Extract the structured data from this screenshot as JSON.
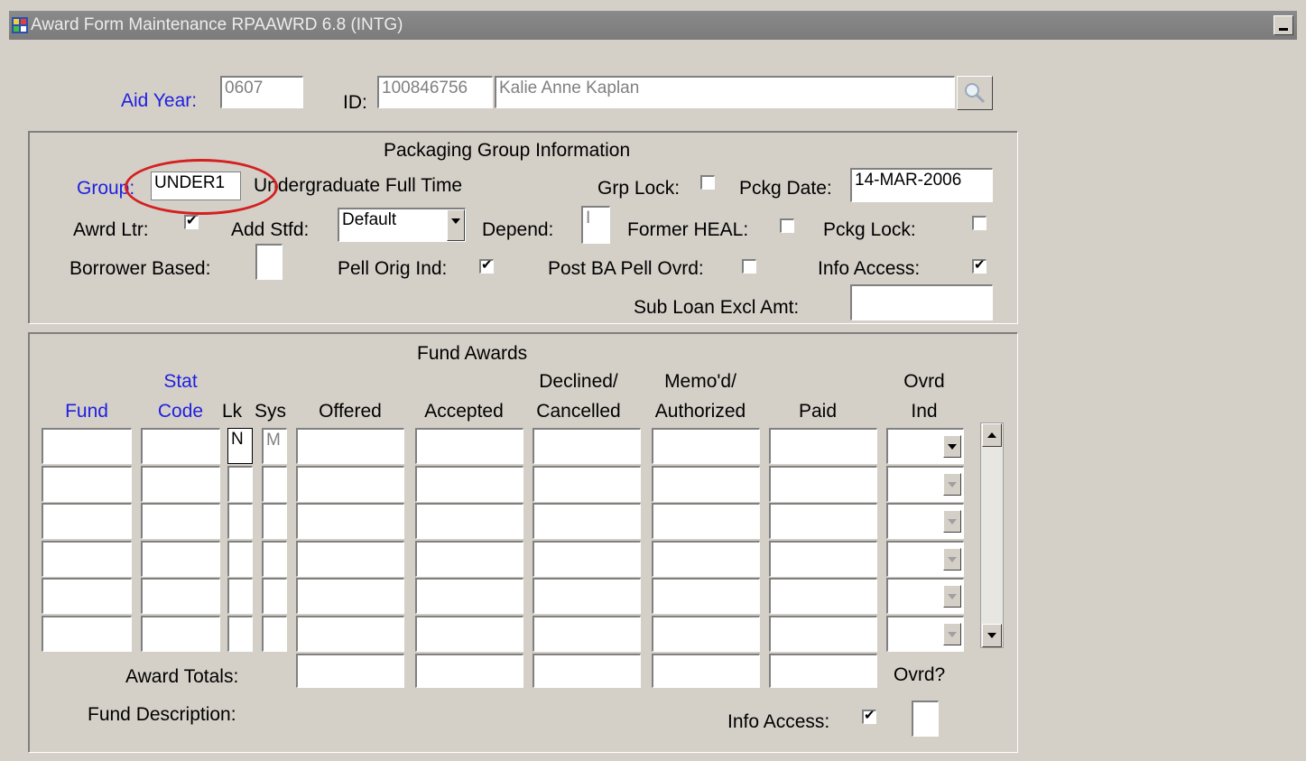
{
  "window": {
    "title": "Award Form Maintenance  RPAAWRD  6.8  (INTG)"
  },
  "key_block": {
    "aid_year_label": "Aid Year:",
    "aid_year_value": "0607",
    "id_label": "ID:",
    "id_value": "100846756",
    "name_value": "Kalie Anne Kaplan"
  },
  "packaging": {
    "title": "Packaging Group Information",
    "group_label": "Group:",
    "group_value": "UNDER1",
    "group_desc": "Undergraduate Full Time",
    "grp_lock_label": "Grp Lock:",
    "grp_lock": false,
    "pckg_date_label": "Pckg Date:",
    "pckg_date_value": "14-MAR-2006",
    "awrd_ltr_label": "Awrd Ltr:",
    "awrd_ltr": true,
    "add_stfd_label": "Add Stfd:",
    "add_stfd_value": "Default",
    "depend_label": "Depend:",
    "depend_value": "I",
    "former_heal_label": "Former HEAL:",
    "former_heal": false,
    "pckg_lock_label": "Pckg Lock:",
    "pckg_lock": false,
    "borrower_based_label": "Borrower Based:",
    "pell_orig_label": "Pell Orig Ind:",
    "pell_orig": true,
    "post_ba_label": "Post BA Pell Ovrd:",
    "post_ba": false,
    "info_access_label": "Info Access:",
    "info_access": true,
    "sub_loan_label": "Sub Loan Excl Amt:"
  },
  "fund_awards": {
    "title": "Fund Awards",
    "col_fund": "Fund",
    "col_stat_1": "Stat",
    "col_stat_2": "Code",
    "col_lk": "Lk",
    "col_sys": "Sys",
    "col_offered": "Offered",
    "col_accepted": "Accepted",
    "col_declined_1": "Declined/",
    "col_declined_2": "Cancelled",
    "col_memo_1": "Memo'd/",
    "col_memo_2": "Authorized",
    "col_paid": "Paid",
    "col_ovrd_1": "Ovrd",
    "col_ovrd_2": "Ind",
    "first_row_lk": "N",
    "first_row_sys": "M",
    "award_totals_label": "Award Totals:",
    "ovrd_q_label": "Ovrd?",
    "fund_desc_label": "Fund Description:",
    "info_access_label": "Info Access:",
    "info_access": true
  },
  "icons": {
    "app": "oracle-forms-icon",
    "search": "magnifier-icon",
    "minimize": "minimize-icon"
  }
}
